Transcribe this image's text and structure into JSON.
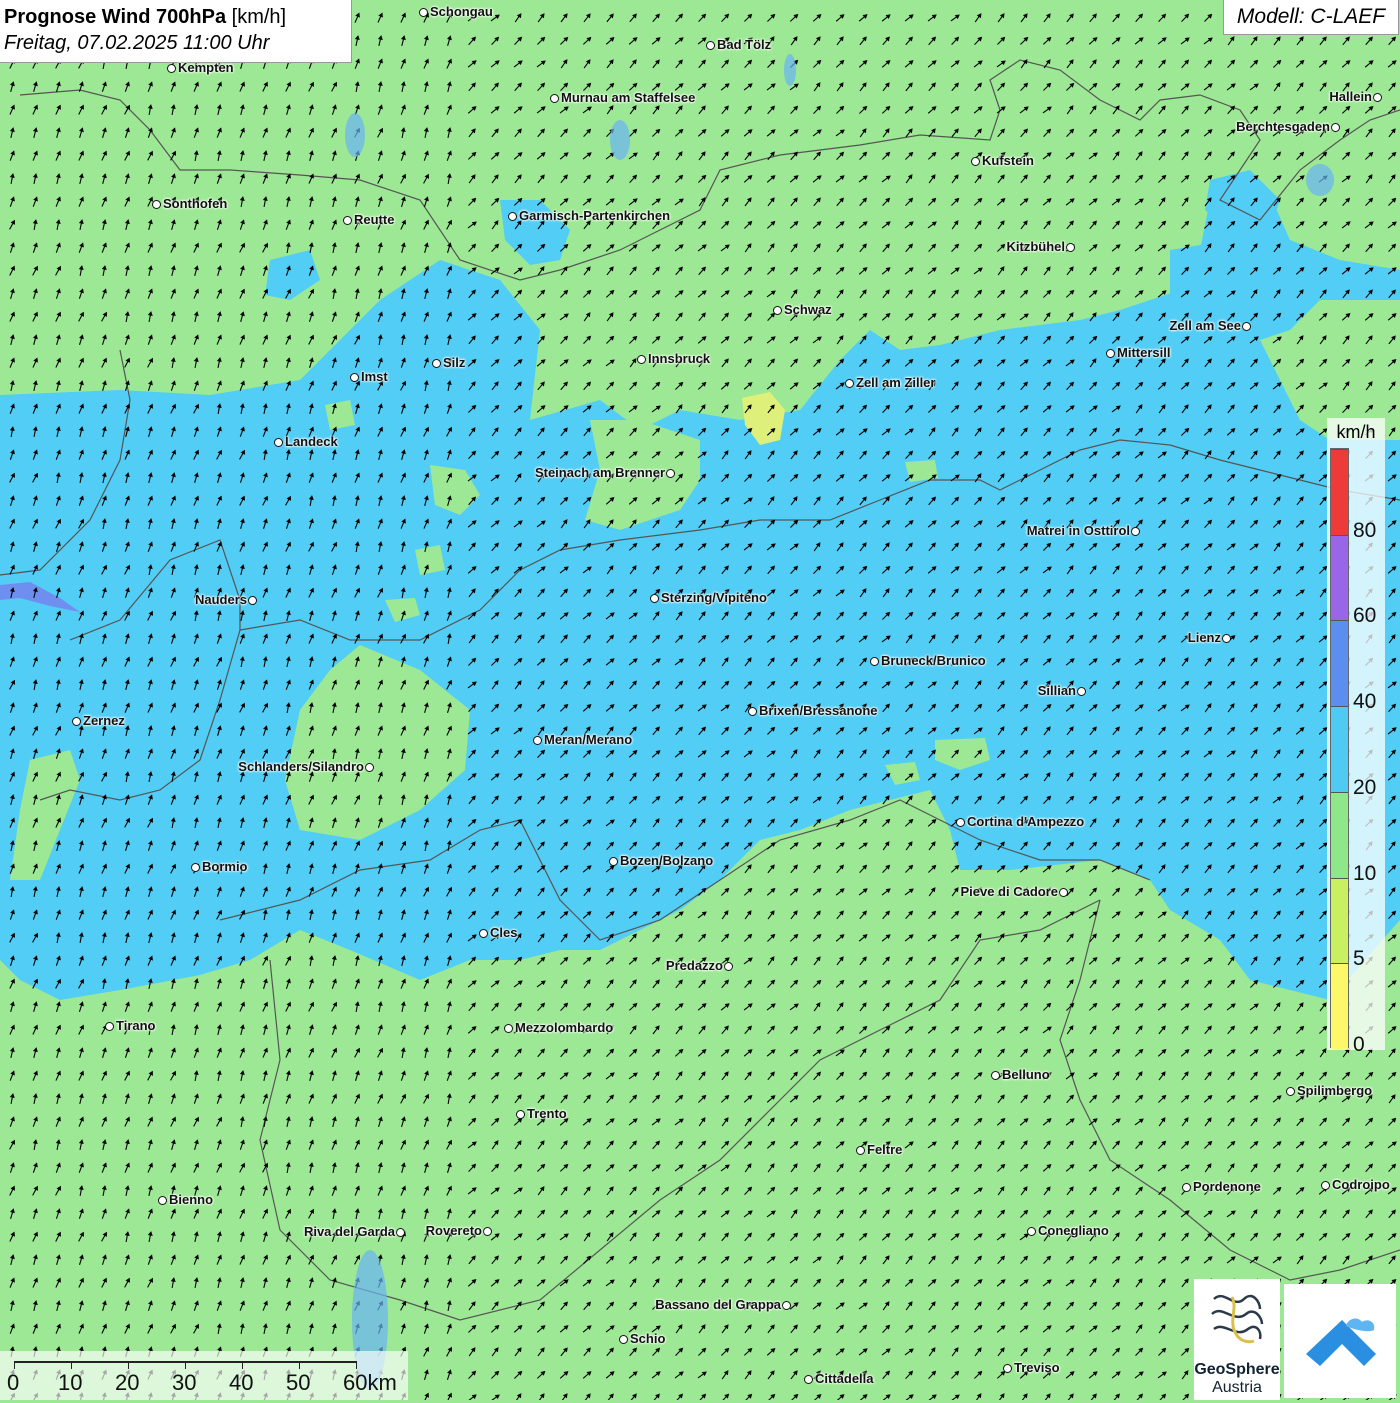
{
  "header": {
    "title_bold": "Prognose Wind 700hPa",
    "title_unit": "[km/h]",
    "subtitle": "Freitag, 07.02.2025 11:00 Uhr",
    "model": "Modell: C-LAEF"
  },
  "legend": {
    "unit": "km/h",
    "classes": [
      {
        "label": "0",
        "color": "#fdf76a"
      },
      {
        "label": "5",
        "color": "#c8f060"
      },
      {
        "label": "10",
        "color": "#8ee88a"
      },
      {
        "label": "20",
        "color": "#4fcaf3"
      },
      {
        "label": "40",
        "color": "#5c8ef0"
      },
      {
        "label": "60",
        "color": "#9a66e8"
      },
      {
        "label": "80",
        "color": "#ef3a3a"
      }
    ]
  },
  "scale_bar": {
    "labels": [
      "0",
      "10",
      "20",
      "30",
      "40",
      "50",
      "60km"
    ]
  },
  "logos": {
    "geosphere_line1": "GeoSphere",
    "geosphere_line2": "Austria"
  },
  "map": {
    "colors": {
      "background": "#9ce894",
      "wind_20_40": "#52cdf5",
      "wind_40_60": "#5c8ef0",
      "wind_5_10": "#dff07a",
      "border": "#555555"
    },
    "cities": [
      {
        "name": "Schongau"
      },
      {
        "name": "Bad Tölz"
      },
      {
        "name": "Kempten"
      },
      {
        "name": "Murnau am Staffelsee"
      },
      {
        "name": "Hallein"
      },
      {
        "name": "Berchtesgaden"
      },
      {
        "name": "Kufstein"
      },
      {
        "name": "Sonthofen"
      },
      {
        "name": "Reutte"
      },
      {
        "name": "Garmisch-Partenkirchen"
      },
      {
        "name": "Kitzbühel"
      },
      {
        "name": "Schwaz"
      },
      {
        "name": "Zell am See"
      },
      {
        "name": "Mittersill"
      },
      {
        "name": "Innsbruck"
      },
      {
        "name": "Imst"
      },
      {
        "name": "Silz"
      },
      {
        "name": "Zell am Ziller"
      },
      {
        "name": "Landeck"
      },
      {
        "name": "Steinach am Brenner"
      },
      {
        "name": "Matrei in Osttirol"
      },
      {
        "name": "Nauders"
      },
      {
        "name": "Sterzing/Vipiteno"
      },
      {
        "name": "Lienz"
      },
      {
        "name": "Bruneck/Brunico"
      },
      {
        "name": "Sillian"
      },
      {
        "name": "Brixen/Bressanone"
      },
      {
        "name": "Zernez"
      },
      {
        "name": "Meran/Merano"
      },
      {
        "name": "Schlanders/Silandro"
      },
      {
        "name": "Cortina d'Ampezzo"
      },
      {
        "name": "Bormio"
      },
      {
        "name": "Bozen/Bolzano"
      },
      {
        "name": "Pieve di Cadore"
      },
      {
        "name": "Cles"
      },
      {
        "name": "Predazzo"
      },
      {
        "name": "Tirano"
      },
      {
        "name": "Mezzolombardo"
      },
      {
        "name": "Belluno"
      },
      {
        "name": "Spilimbergo"
      },
      {
        "name": "Trento"
      },
      {
        "name": "Feltre"
      },
      {
        "name": "Bienno"
      },
      {
        "name": "Pordenone"
      },
      {
        "name": "Codroipo"
      },
      {
        "name": "Riva del Garda"
      },
      {
        "name": "Rovereto"
      },
      {
        "name": "Conegliano"
      },
      {
        "name": "Bassano del Grappa"
      },
      {
        "name": "Schio"
      },
      {
        "name": "Treviso"
      },
      {
        "name": "Cittadella"
      }
    ]
  }
}
